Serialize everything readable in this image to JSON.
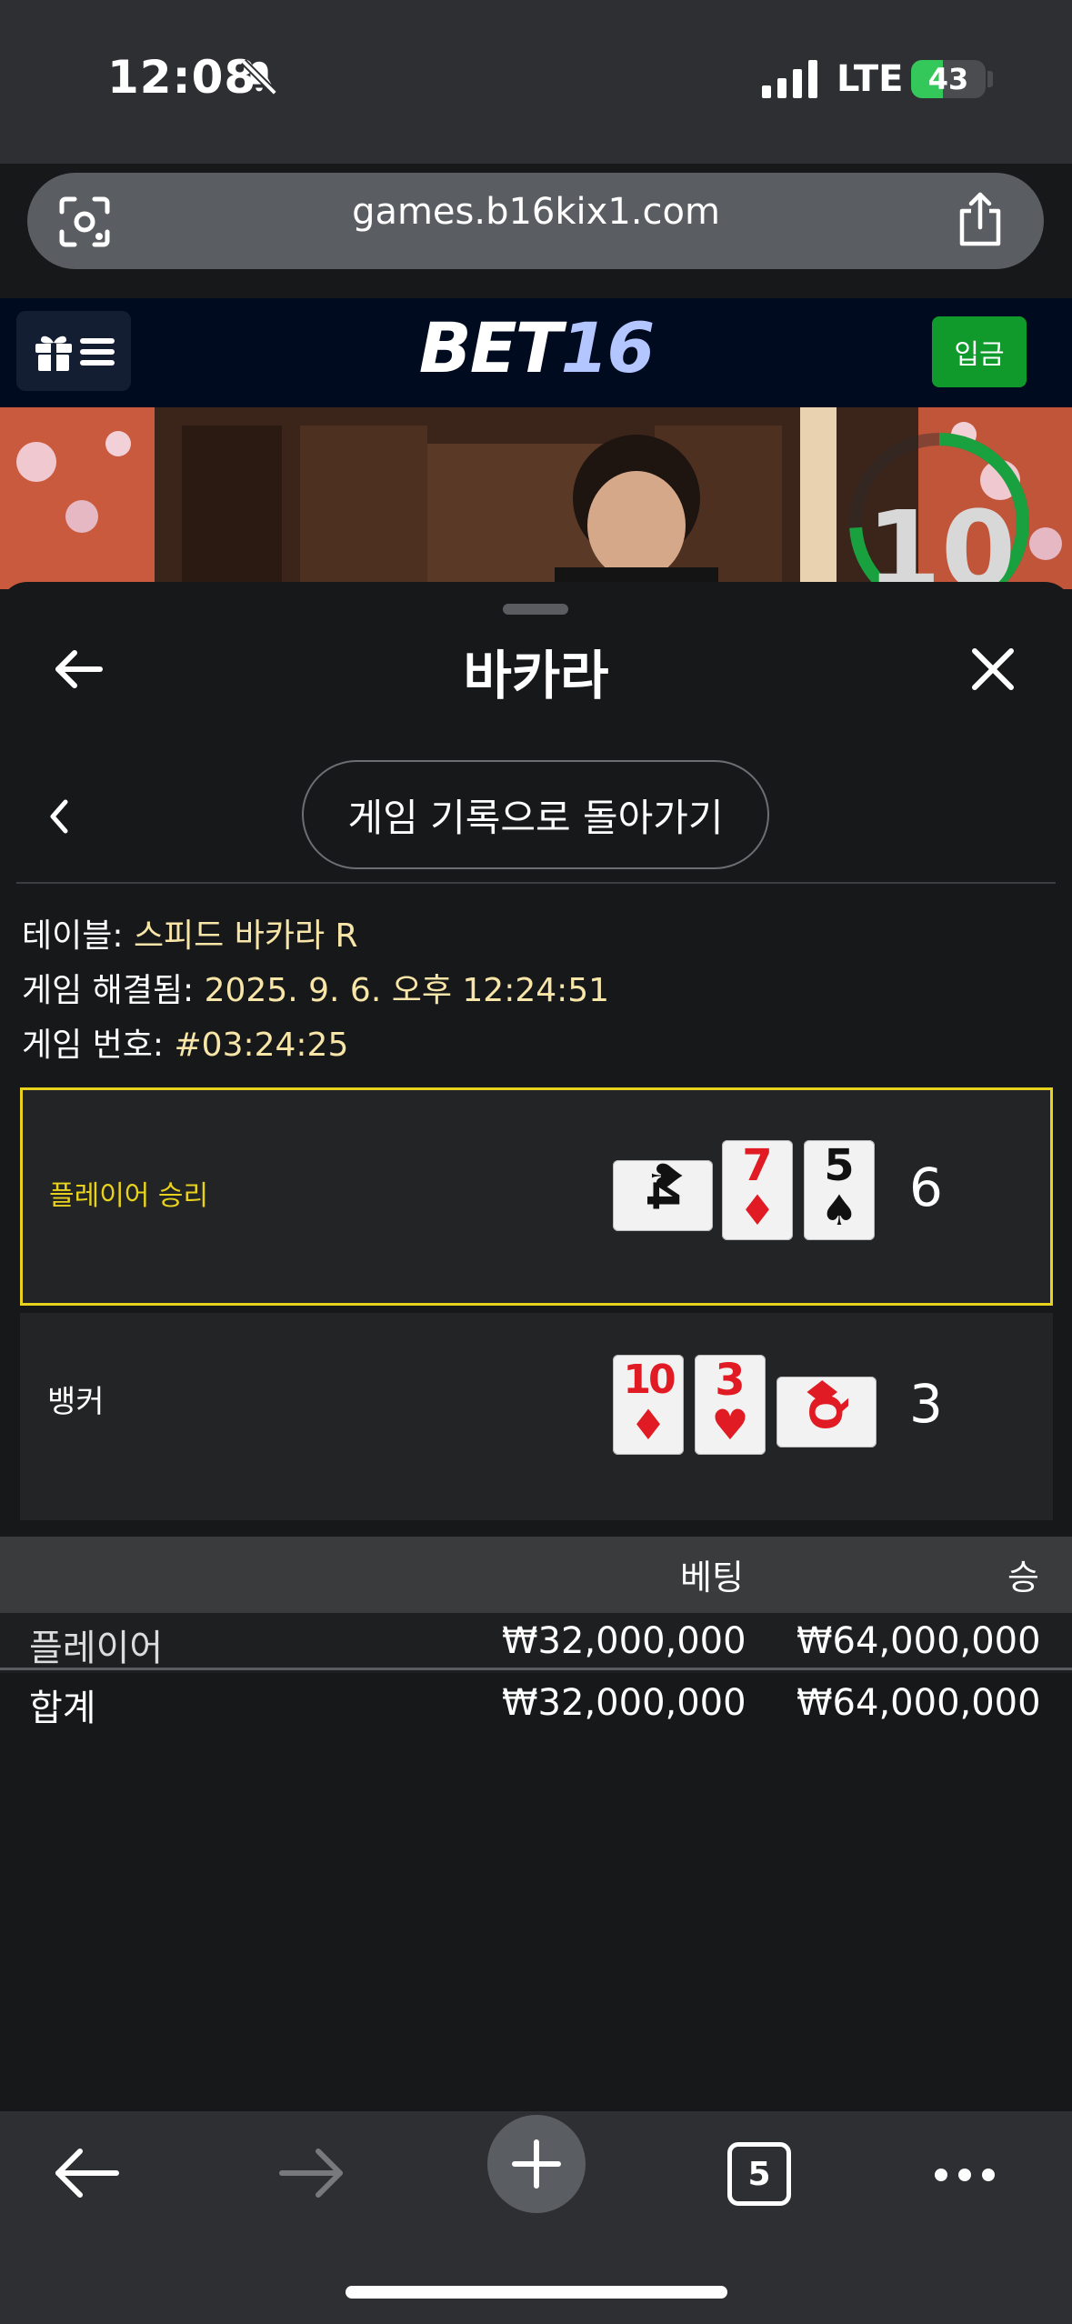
{
  "status_bar": {
    "time": "12:08",
    "network": "LTE",
    "battery": "43",
    "battery_level": 0.43
  },
  "browser": {
    "url": "games.b16kix1.com",
    "tab_count": "5"
  },
  "site_header": {
    "logo_part1": "BET",
    "logo_part2": "16",
    "deposit_label": "입금"
  },
  "video": {
    "countdown": "10"
  },
  "sheet": {
    "title": "바카라",
    "history_button": "게임 기록으로 돌아가기",
    "info": [
      {
        "label": "테이블: ",
        "value": "스피드 바카라 R"
      },
      {
        "label": "게임 해결됨: ",
        "value": "2025. 9. 6. 오후 12:24:51"
      },
      {
        "label": "게임 번호: ",
        "value": "#03:24:25"
      }
    ],
    "player": {
      "label": "플레이어 승리",
      "score": "6",
      "cards": [
        {
          "rank": "4",
          "suit": "♠",
          "color": "black"
        },
        {
          "rank": "7",
          "suit": "♦",
          "color": "red"
        },
        {
          "rank": "5",
          "suit": "♠",
          "color": "black"
        }
      ]
    },
    "banker": {
      "label": "뱅커",
      "score": "3",
      "cards": [
        {
          "rank": "10",
          "suit": "♦",
          "color": "red"
        },
        {
          "rank": "3",
          "suit": "♥",
          "color": "red"
        },
        {
          "rank": "Q",
          "suit": "♦",
          "color": "red"
        }
      ]
    }
  },
  "bets_table": {
    "headers": {
      "bet": "베팅",
      "win": "승"
    },
    "rows": [
      {
        "label": "플레이어",
        "bet": "₩32,000,000",
        "win": "₩64,000,000"
      }
    ],
    "total": {
      "label": "합계",
      "bet": "₩32,000,000",
      "win": "₩64,000,000"
    }
  },
  "colors": {
    "accent_win": "#e8d21d",
    "deposit": "#109a2c",
    "info_value": "#f8e6a8",
    "card_red": "#e01b24"
  }
}
